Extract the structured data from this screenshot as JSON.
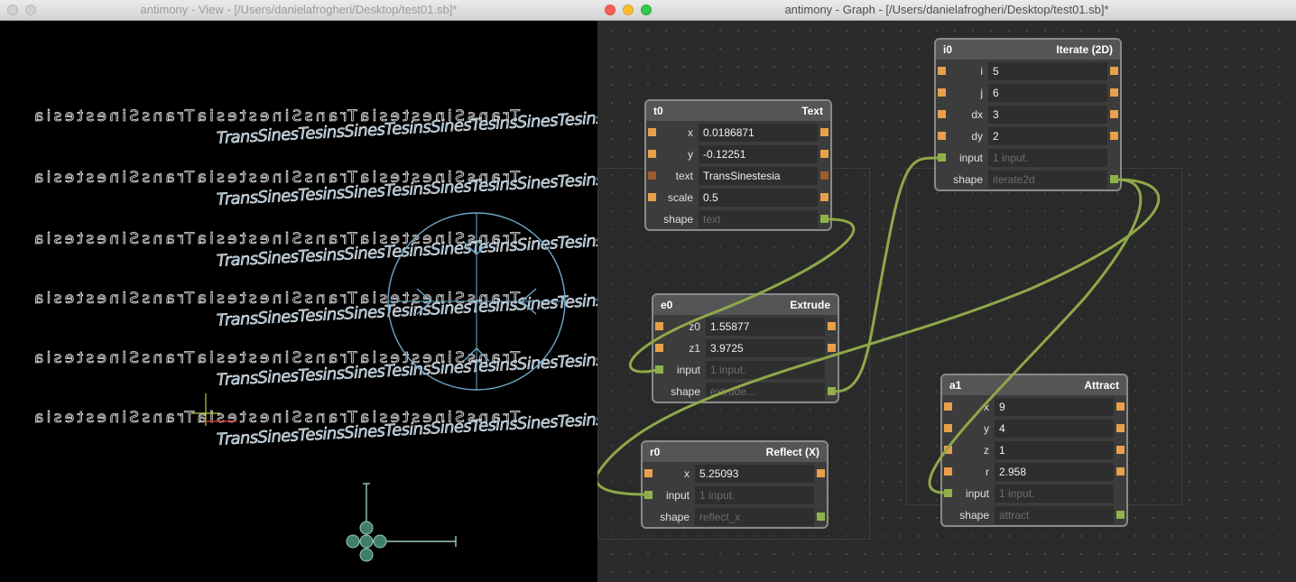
{
  "view_window": {
    "title": "antimony - View - [/Users/danielafrogheri/Desktop/test01.sb]*",
    "text_rows": {
      "mirrored": "TransSinestesiaTransSinestesiaTransSinestesia",
      "sheared": "TransSinesTesinsSinesTesinsSinesTesinsSinesTesins"
    }
  },
  "graph_window": {
    "title": "antimony - Graph - [/Users/danielafrogheri/Desktop/test01.sb]*",
    "nodes": {
      "t0": {
        "id": "t0",
        "type": "Text",
        "rows": [
          {
            "label": "x",
            "value": "0.0186871"
          },
          {
            "label": "y",
            "value": "-0.12251"
          },
          {
            "label": "text",
            "value": "TransSinestesia"
          },
          {
            "label": "scale",
            "value": "0.5"
          },
          {
            "label": "shape",
            "value": "text"
          }
        ]
      },
      "e0": {
        "id": "e0",
        "type": "Extrude",
        "rows": [
          {
            "label": "z0",
            "value": "1.55877"
          },
          {
            "label": "z1",
            "value": "3.9725"
          },
          {
            "label": "input",
            "value": "1 input."
          },
          {
            "label": "shape",
            "value": "extrude..."
          }
        ]
      },
      "r0": {
        "id": "r0",
        "type": "Reflect (X)",
        "rows": [
          {
            "label": "x",
            "value": "5.25093"
          },
          {
            "label": "input",
            "value": "1 input."
          },
          {
            "label": "shape",
            "value": "reflect_x"
          }
        ]
      },
      "i0": {
        "id": "i0",
        "type": "Iterate (2D)",
        "rows": [
          {
            "label": "i",
            "value": "5"
          },
          {
            "label": "j",
            "value": "6"
          },
          {
            "label": "dx",
            "value": "3"
          },
          {
            "label": "dy",
            "value": "2"
          },
          {
            "label": "input",
            "value": "1 input."
          },
          {
            "label": "shape",
            "value": "iterate2d"
          }
        ]
      },
      "a1": {
        "id": "a1",
        "type": "Attract",
        "rows": [
          {
            "label": "x",
            "value": "9"
          },
          {
            "label": "y",
            "value": "4"
          },
          {
            "label": "z",
            "value": "1"
          },
          {
            "label": "r",
            "value": "2.958"
          },
          {
            "label": "input",
            "value": "1 input."
          },
          {
            "label": "shape",
            "value": "attract"
          }
        ]
      }
    }
  },
  "colors": {
    "wire": "#8fa84a",
    "port_float": "#e8a04a",
    "port_string": "#a05a30",
    "port_shape": "#8fb34a",
    "gizmo": "#6fa8c8"
  }
}
